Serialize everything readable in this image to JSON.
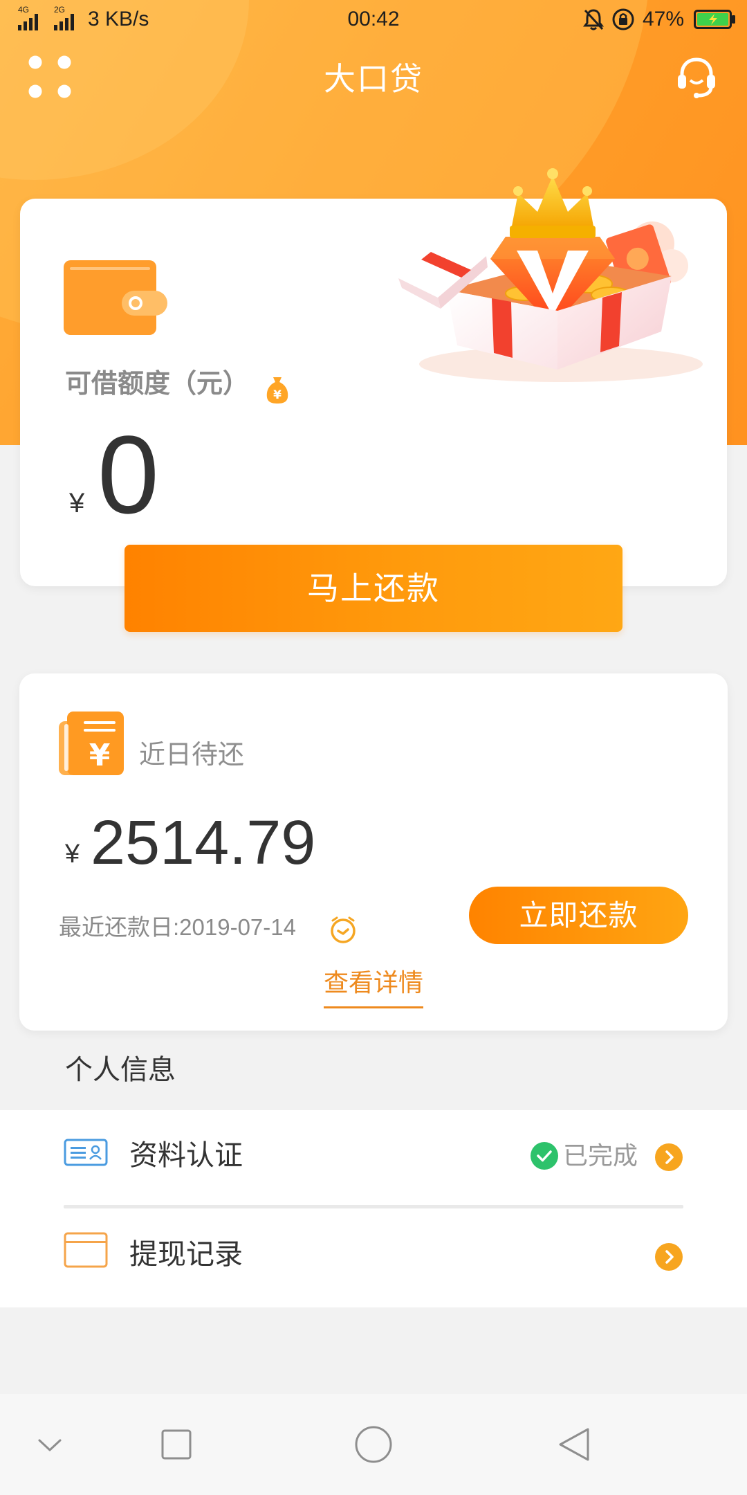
{
  "status_bar": {
    "network_primary": "4G",
    "network_secondary": "2G",
    "speed": "3 KB/s",
    "time": "00:42",
    "battery": "47%",
    "icons": [
      "signal-icon",
      "signal-icon",
      "mute-bell-icon",
      "rotation-lock-icon",
      "battery-charging-icon"
    ]
  },
  "header": {
    "title": "大口贷",
    "left_icon": "menu-grid-icon",
    "right_icon": "customer-service-icon"
  },
  "credit_card": {
    "label": "可借额度（元）",
    "bag_glyph": "¥",
    "currency": "¥",
    "amount": "0",
    "button_label": "马上还款",
    "icons": [
      "wallet-icon",
      "money-bag-icon",
      "gift-box-illustration"
    ]
  },
  "repay_card": {
    "icon_glyph": "¥",
    "title": "近日待还",
    "currency": "¥",
    "amount": "2514.79",
    "due_date_label": "最近还款日:2019-07-14",
    "button_label": "立即还款",
    "details_link": "查看详情",
    "icons": [
      "bill-icon",
      "clock-icon"
    ]
  },
  "personal_info": {
    "section_title": "个人信息",
    "items": [
      {
        "label": "资料认证",
        "status": "已完成",
        "icon": "id-card-icon",
        "status_icon": "check-circle-icon",
        "arrow_icon": "chevron-right-icon"
      },
      {
        "label": "提现记录",
        "icon": "bank-card-icon",
        "arrow_icon": "chevron-right-icon"
      }
    ]
  },
  "nav_bar": {
    "icons": [
      "collapse-icon",
      "recents-icon",
      "home-icon",
      "back-icon"
    ]
  },
  "colors": {
    "primary": "#FF9A1F",
    "primary_dark": "#FF8200",
    "accent_text": "#EE8A1E",
    "success": "#2DC26B",
    "info_blue": "#4A9BE0",
    "background": "#F2F2F2",
    "card": "#FFFFFF"
  }
}
